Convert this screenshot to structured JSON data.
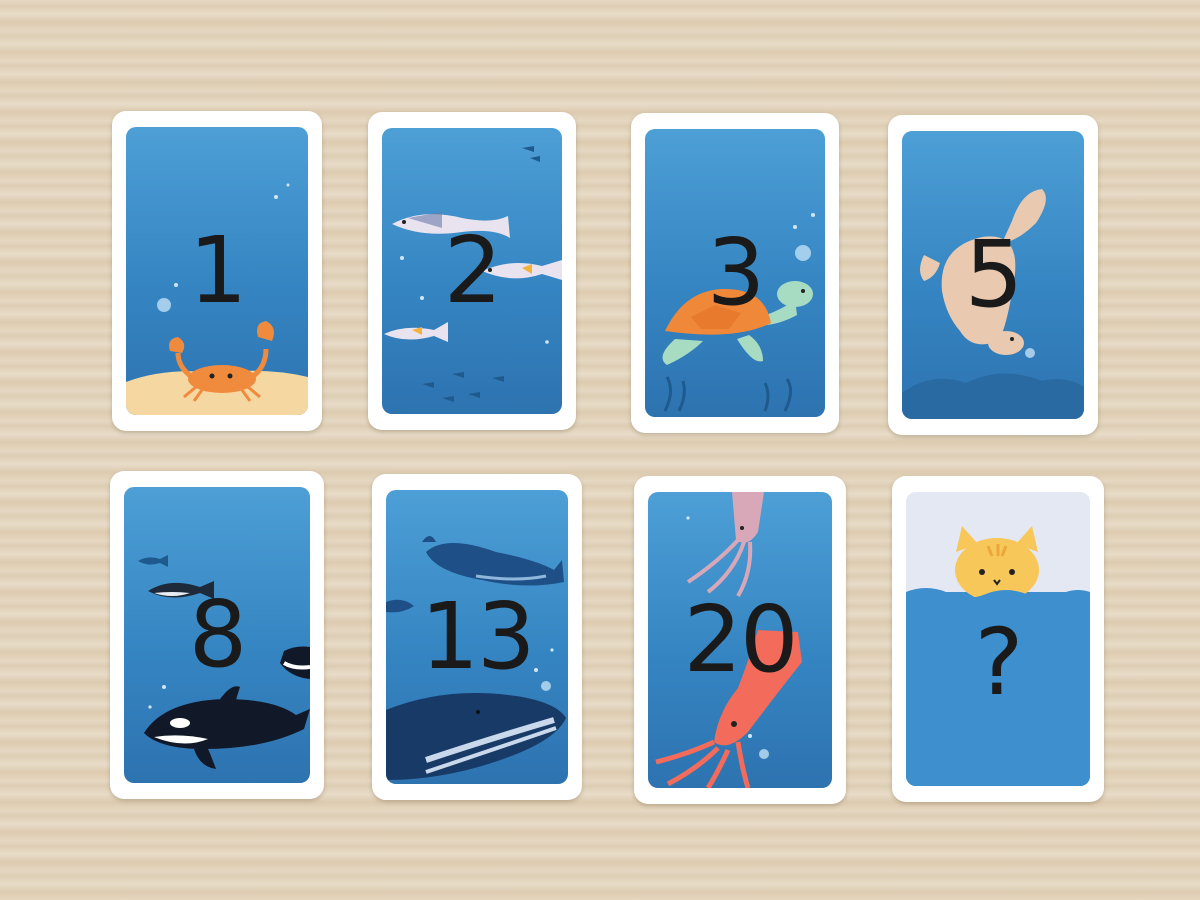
{
  "cards": [
    {
      "value": "1",
      "creature": "crab"
    },
    {
      "value": "2",
      "creature": "fish-school"
    },
    {
      "value": "3",
      "creature": "sea-turtle"
    },
    {
      "value": "5",
      "creature": "seal"
    },
    {
      "value": "8",
      "creature": "orca"
    },
    {
      "value": "13",
      "creature": "humpback-whale"
    },
    {
      "value": "20",
      "creature": "squid"
    },
    {
      "value": "?",
      "creature": "cat"
    }
  ],
  "colors": {
    "table": "#e4d6bf",
    "card_border": "#ffffff",
    "ocean": "#3585c2",
    "numeral": "#1a1a1a",
    "sand": "#f4d7a1",
    "crab": "#f08a3c",
    "turtle_shell": "#f0883a",
    "turtle_body": "#a7dcc2",
    "seal": "#e9c9b0",
    "orca": "#111827",
    "squid": "#f26b5b",
    "cat": "#f7c75a"
  }
}
